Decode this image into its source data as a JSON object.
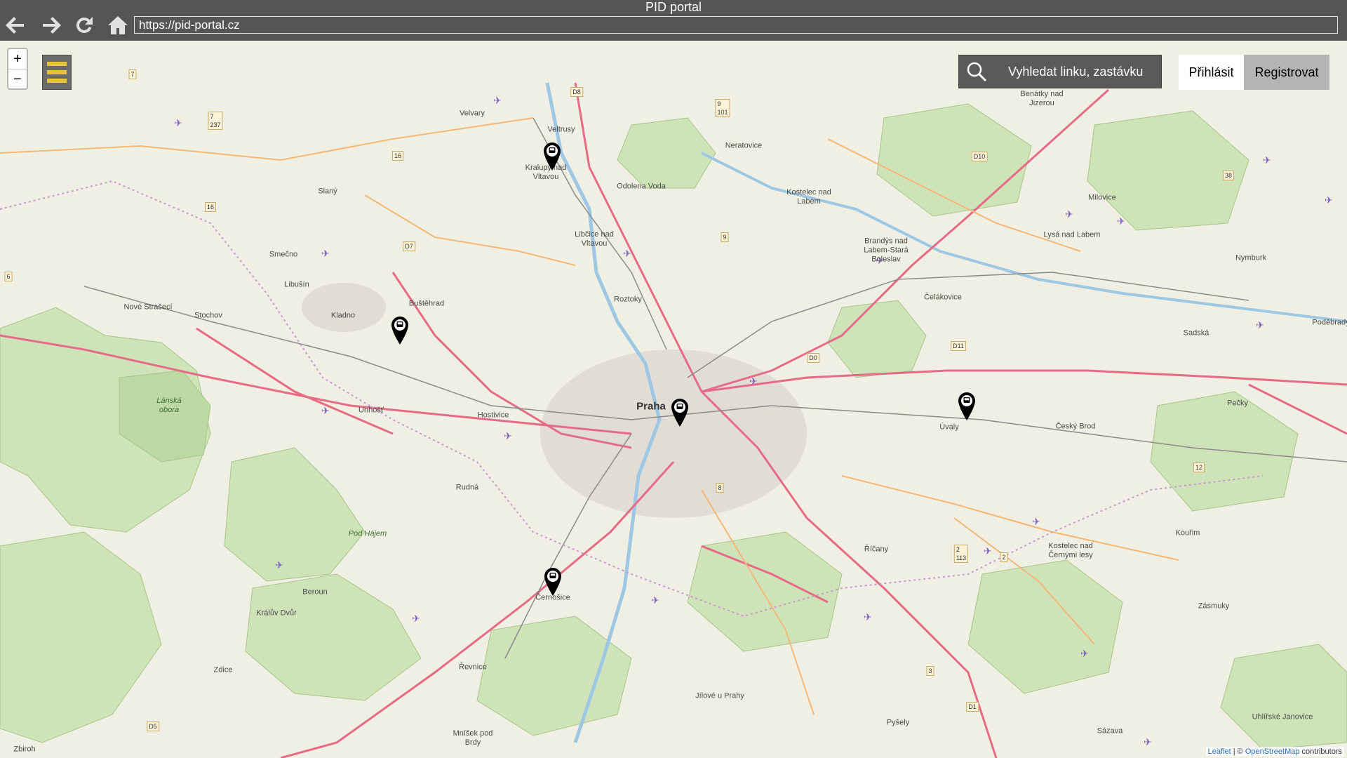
{
  "window": {
    "title": "PID portal"
  },
  "address_bar": {
    "url": "https://pid-portal.cz"
  },
  "toolbar": {
    "back_icon": "arrow-left-icon",
    "forward_icon": "arrow-right-icon",
    "reload_icon": "reload-icon",
    "home_icon": "home-icon"
  },
  "map_controls": {
    "zoom_in_label": "+",
    "zoom_out_label": "−",
    "menu_icon": "hamburger-menu-icon"
  },
  "search": {
    "label": "Vyhledat linku, zastávku",
    "icon": "search-icon"
  },
  "auth": {
    "login_label": "Přihlásit",
    "register_label": "Registrovat"
  },
  "colors": {
    "chrome": "#555555",
    "menu_accent": "#e7c43c",
    "road": "#e56b86",
    "map_bg": "#f0efe3",
    "forest": "#cfe3b8"
  },
  "places": [
    {
      "name": "Praha"
    },
    {
      "name": "Kralupy nad\nVltavou"
    },
    {
      "name": "Veltrusy"
    },
    {
      "name": "Velvary"
    },
    {
      "name": "Odolena Voda"
    },
    {
      "name": "Neratovice"
    },
    {
      "name": "Kostelec nad\nLabem"
    },
    {
      "name": "Benátky nad\nJizerou"
    },
    {
      "name": "Milovice"
    },
    {
      "name": "Lysá nad Labem"
    },
    {
      "name": "Nymburk"
    },
    {
      "name": "Brandýs nad\nLabem-Stará\nBoleslav"
    },
    {
      "name": "Čelákovice"
    },
    {
      "name": "Sadská"
    },
    {
      "name": "Poděbrady"
    },
    {
      "name": "Slaný"
    },
    {
      "name": "Smečno"
    },
    {
      "name": "Libušín"
    },
    {
      "name": "Nové Strašecí"
    },
    {
      "name": "Stochov"
    },
    {
      "name": "Kladno"
    },
    {
      "name": "Buštěhrad"
    },
    {
      "name": "Libčice nad\nVltavou"
    },
    {
      "name": "Roztoky"
    },
    {
      "name": "Unhošť"
    },
    {
      "name": "Hostivice"
    },
    {
      "name": "Rudná"
    },
    {
      "name": "Úvaly"
    },
    {
      "name": "Český Brod"
    },
    {
      "name": "Pečky"
    },
    {
      "name": "Říčany"
    },
    {
      "name": "Kostelec nad\nČernými lesy"
    },
    {
      "name": "Kouřim"
    },
    {
      "name": "Zásmuky"
    },
    {
      "name": "Beroun"
    },
    {
      "name": "Králův Dvůr"
    },
    {
      "name": "Černošice"
    },
    {
      "name": "Řevnice"
    },
    {
      "name": "Zdice"
    },
    {
      "name": "Jílové u Prahy"
    },
    {
      "name": "Pyšely"
    },
    {
      "name": "Mníšek pod\nBrdy"
    },
    {
      "name": "Sázava"
    },
    {
      "name": "Uhlířské Janovice"
    },
    {
      "name": "Zbiroh"
    },
    {
      "name": "Lánská\nobora"
    },
    {
      "name": "Pod Hájem"
    }
  ],
  "road_numbers": [
    "D8",
    "D7",
    "D10",
    "D11",
    "D0",
    "D1",
    "D5",
    "9\n101",
    "16",
    "16",
    "7",
    "7\n237",
    "38",
    "12",
    "2\n113",
    "2",
    "3",
    "9",
    "6",
    "8"
  ],
  "stop_markers": [
    {
      "name": "stop-kralupy"
    },
    {
      "name": "stop-kladno"
    },
    {
      "name": "stop-praha"
    },
    {
      "name": "stop-uvaly"
    },
    {
      "name": "stop-cernosice"
    }
  ],
  "attribution": {
    "leaflet": "Leaflet",
    "separator": " | © ",
    "osm": "OpenStreetMap",
    "suffix": " contributors"
  }
}
